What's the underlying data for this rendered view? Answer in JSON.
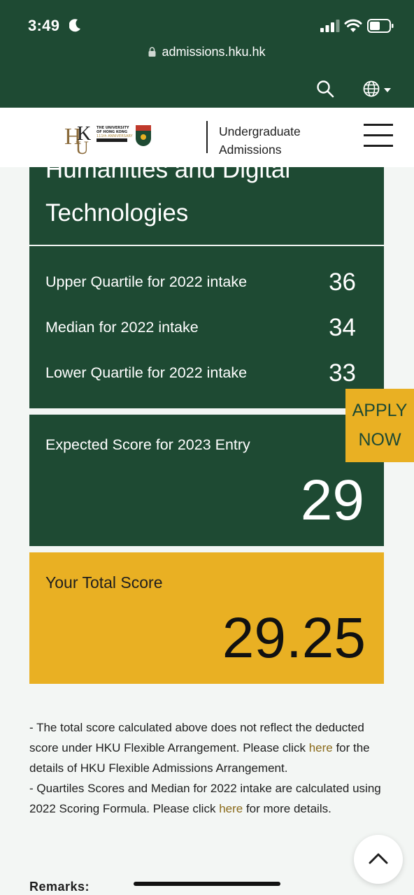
{
  "status_bar": {
    "time": "3:49"
  },
  "browser": {
    "url": "admissions.hku.hk"
  },
  "header": {
    "site_title_line1": "Undergraduate",
    "site_title_line2": "Admissions",
    "logo_text": "THE UNIVERSITY OF HONG KONG 111th ANNIVERSARY"
  },
  "programme": {
    "title_partial": "Humanities and Digital",
    "title_line2": "Technologies"
  },
  "quartiles": [
    {
      "label": "Upper Quartile for 2022 intake",
      "value": "36"
    },
    {
      "label": "Median for 2022 intake",
      "value": "34"
    },
    {
      "label": "Lower Quartile for 2022 intake",
      "value": "33"
    }
  ],
  "expected": {
    "label": "Expected Score for 2023 Entry",
    "value": "29"
  },
  "apply": {
    "line1": "APPLY",
    "line2": "NOW"
  },
  "total_score": {
    "label": "Your Total Score",
    "value": "29.25"
  },
  "notes": {
    "p1_before": "- The total score calculated above does not reflect the deducted score under HKU Flexible Arrangement. Please click ",
    "p1_link": "here",
    "p1_after": " for the details of HKU Flexible Admissions Arrangement.",
    "p2_before": "- Quartiles Scores and Median for 2022 intake are calculated using 2022 Scoring Formula. Please click ",
    "p2_link": "here",
    "p2_after": " for more details."
  },
  "remarks_label": "Remarks:",
  "colors": {
    "green": "#1e4a33",
    "gold": "#e9b023",
    "link": "#8a6a1a"
  }
}
